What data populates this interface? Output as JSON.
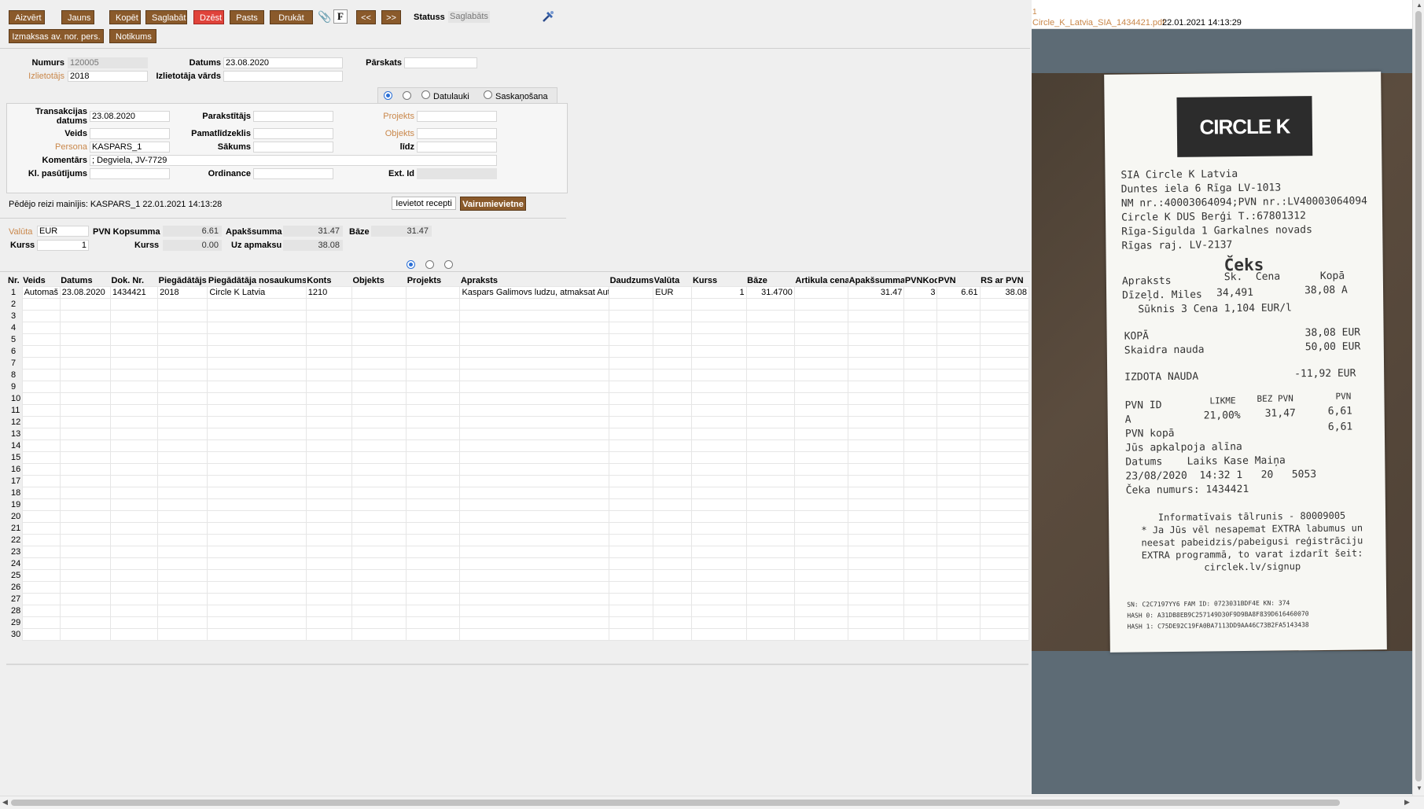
{
  "toolbar": {
    "close": "Aizvērt",
    "new": "Jauns",
    "copy": "Kopēt",
    "save": "Saglabāt",
    "delete": "Dzēst",
    "mail": "Pasts",
    "print": "Drukāt",
    "prev": "<<",
    "next": ">>",
    "status_label": "Statuss",
    "status_value": "Saglabāts",
    "payments": "Izmaksas av. nor. pers.",
    "events": "Notikums"
  },
  "header": {
    "number_label": "Numurs",
    "number_value": "120005",
    "date_label": "Datums",
    "date_value": "23.08.2020",
    "report_label": "Pārskats",
    "report_value": "",
    "payee_label": "Izlietotājs",
    "payee_value": "2018",
    "payee_name_label": "Izlietotāja vārds",
    "payee_name_value": ""
  },
  "tabs": {
    "date_fields": "Datulauki",
    "matching": "Saskaņošana"
  },
  "details": {
    "trans_date_label_1": "Transakcijas",
    "trans_date_label_2": "datums",
    "trans_date_value": "23.08.2020",
    "signed_label": "Parakstītājs",
    "signed_value": "",
    "project_label": "Projekts",
    "project_value": "",
    "type_label": "Veids",
    "type_value": "",
    "asset_label": "Pamatlīdzeklis",
    "asset_value": "",
    "object_label": "Objekts",
    "object_value": "",
    "person_label": "Persona",
    "person_value": "KASPARS_1",
    "start_label": "Sākums",
    "start_value": "",
    "until_label": "līdz",
    "until_value": "",
    "comment_label": "Komentārs",
    "comment_value": "; Degviela, JV-7729",
    "order_label": "Kl. pasūtījums",
    "order_value": "",
    "ordinance_label": "Ordinance",
    "ordinance_value": "",
    "ext_label": "Ext. Id",
    "ext_value": ""
  },
  "last_changed": "Pēdējo reizi mainījis: KASPARS_1 22.01.2021 14:13:28",
  "actions": {
    "import_receipt": "Ievietot recepti",
    "merchant": "Vairumievietne"
  },
  "totals": {
    "currency_label": "Valūta",
    "currency_value": "EUR",
    "vat_total_label": "PVN Kopsumma",
    "vat_total_value": "6.61",
    "subtotal_label": "Apakšsumma",
    "subtotal_value": "31.47",
    "base_label": "Bāze",
    "base_value": "31.47",
    "rate_label": "Kurss",
    "rate_value": "1",
    "rate2_label": "Kurss",
    "rate2_value": "0.00",
    "to_pay_label": "Uz apmaksu",
    "to_pay_value": "38.08"
  },
  "table": {
    "columns": [
      "Nr.",
      "Veids",
      "Datums",
      "Dok. Nr.",
      "Piegādātājs",
      "Piegādātāja nosaukums",
      "Konts",
      "Objekts",
      "Projekts",
      "Apraksts",
      "Daudzums",
      "Valūta",
      "Kurss",
      "Bāze",
      "Artikula cena",
      "Apakšsumma",
      "PVNKods",
      "PVN",
      "RS ar PVN"
    ],
    "row1": {
      "type": "Automaš",
      "date": "23.08.2020",
      "doc": "1434421",
      "supplier": "2018",
      "supplier_name": "Circle K Latvia",
      "account": "1210",
      "object": "",
      "project": "",
      "description": "Kaspars Galimovs ludzu, atmaksat Aut",
      "qty": "",
      "currency": "EUR",
      "rate": "1",
      "base": "31.4700",
      "item_price": "",
      "subtotal": "31.47",
      "vat_code": "3",
      "vat": "6.61",
      "total": "38.08"
    }
  },
  "attachment": {
    "index": "1",
    "filename": "Circle_K_Latvia_SIA_1434421.pdf",
    "timestamp": "22.01.2021 14:13:29"
  },
  "receipt": {
    "logo": "CIRCLE K",
    "lines": [
      "SIA Circle K Latvia",
      "Duntes iela 6 Rīga LV-1013",
      "NM nr.:40003064094;PVN nr.:LV40003064094",
      "Circle K DUS Berģi T.:67801312",
      "Rīga-Sigulda 1 Garkalnes novads",
      "Rīgas raj. LV-2137"
    ],
    "title": "Čeks",
    "head": [
      "Apraksts",
      "Sk.",
      "Cena",
      "Kopā"
    ],
    "item": [
      "Dīzeļd. Miles",
      "34,491",
      "38,08 A"
    ],
    "item_sub": "Sūknis  3  Cena  1,104 EUR/l",
    "kopa_label": "KOPĀ",
    "kopa_value": "38,08 EUR",
    "cash_label": "Skaidra nauda",
    "cash_value": "50,00 EUR",
    "change_label": "IZDOTA NAUDA",
    "change_value": "-11,92 EUR",
    "vat_head": [
      "PVN ID",
      "LIKME",
      "BEZ PVN",
      "PVN"
    ],
    "vat_row": [
      "A",
      "21,00%",
      "31,47",
      "6,61"
    ],
    "vat_total_label": "PVN kopā",
    "vat_total_value": "6,61",
    "served": "Jūs apkalpoja alīna",
    "dt_head": "Datums    Laiks Kase Maiņa",
    "dt_row": "23/08/2020  14:32 1   20   5053",
    "receipt_no": "Čeka numurs: 1434421",
    "info1": "Informatīvais tālrunis - 80009005",
    "info2": "* Ja Jūs vēl nesapemat EXTRA labumus un",
    "info3": "neesat pabeidzis/pabeigusi reģistrāciju",
    "info4": "EXTRA programmā, to varat izdarīt šeit:",
    "info5": "circlek.lv/signup",
    "sn": "SN: C2C7197YY6 FAM ID: 0723031BDF4E KN: 374",
    "hash0": "HASH 0: A31DB8EB9C257149D30F9D9BA8F839D616460070",
    "hash1": "HASH 1: C75DE92C19FA0BA7113DD9AA46C73B2FA5143438"
  }
}
